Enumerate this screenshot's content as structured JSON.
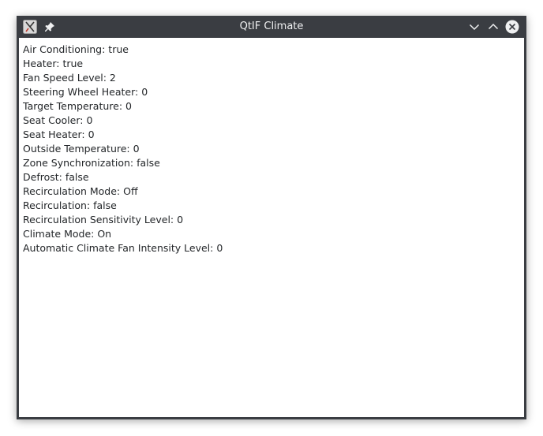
{
  "window": {
    "title": "QtIF Climate"
  },
  "icons": {
    "app": "qt-x-icon",
    "pin": "pin-icon",
    "minimize": "chevron-down-icon",
    "maximize": "chevron-up-icon",
    "close": "close-circle-icon"
  },
  "colors": {
    "titlebar": "#3a3d42",
    "title_text": "#eff0f1",
    "content_bg": "#ffffff",
    "text": "#232629"
  },
  "properties": [
    "Air Conditioning: true",
    "Heater: true",
    "Fan Speed Level: 2",
    "Steering Wheel Heater: 0",
    "Target Temperature: 0",
    "Seat Cooler: 0",
    "Seat Heater: 0",
    "Outside Temperature: 0",
    "Zone Synchronization: false",
    "Defrost: false",
    "Recirculation Mode: Off",
    "Recirculation: false",
    "Recirculation Sensitivity Level: 0",
    "Climate Mode: On",
    "Automatic Climate Fan Intensity Level: 0"
  ]
}
